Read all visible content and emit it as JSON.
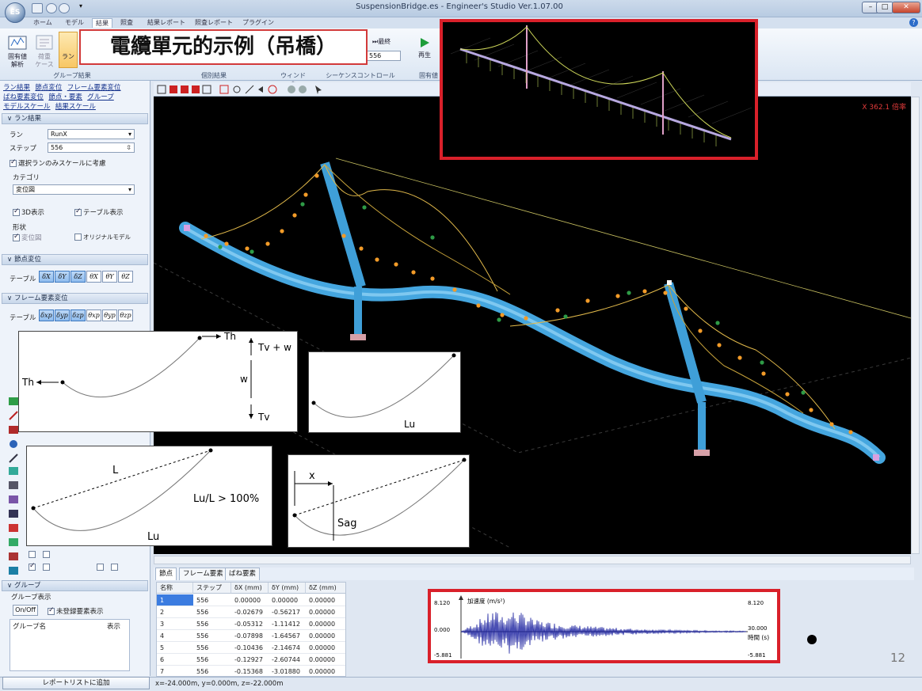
{
  "window": {
    "title": "SuspensionBridge.es - Engineer's Studio Ver.1.07.00",
    "app_logo": "ES",
    "controls": [
      "minimize-icon",
      "maximize-icon",
      "close-icon"
    ]
  },
  "menu": {
    "items": [
      "ホーム",
      "モデル",
      "結果",
      "照査",
      "結果レポート",
      "照査レポート",
      "プラグイン"
    ],
    "active": "結果",
    "help": "?"
  },
  "ribbon": {
    "buttons": {
      "eigen": "固有値\n解析",
      "load_case": "荷重\nケース",
      "run": "ラン",
      "last": "最終",
      "step_value": "556",
      "play": "再生",
      "eigen_short": "固有値"
    },
    "groups": [
      "グループ結果",
      "個別結果",
      "ウィンドウ",
      "シーケンスコントロール",
      "固有値"
    ]
  },
  "overlay_title": "電纜單元的示例（吊橋）",
  "panel": {
    "links_row1": [
      "ラン結果",
      "節点変位",
      "フレーム要素変位"
    ],
    "links_row2": [
      "ばね要素変位",
      "節点・要素",
      "グループ"
    ],
    "links_row3": [
      "モデルスケール",
      "結果スケール"
    ],
    "run_section": {
      "header": "ラン結果",
      "run_label": "ラン",
      "run_value": "RunX",
      "step_label": "ステップ",
      "step_value": "556",
      "scale_check": "選択ランのみスケールに考慮",
      "category_label": "カテゴリ",
      "category_value": "変位図",
      "show_3d": "3D表示",
      "show_table": "テーブル表示",
      "shape_label": "形状",
      "disp_fig": "変位図",
      "original_model": "オリジナルモデル"
    },
    "node_disp": {
      "header": "節点変位",
      "table_label": "テーブル",
      "buttons": [
        "δX",
        "δY",
        "δZ",
        "θX",
        "θY",
        "θZ"
      ]
    },
    "frame_disp": {
      "header": "フレーム要素変位",
      "table_label": "テーブル",
      "buttons": [
        "δxp",
        "δyp",
        "δzp",
        "θxp",
        "θyp",
        "θzp"
      ]
    },
    "group": {
      "header": "グループ",
      "display_label": "グループ表示",
      "onoff": "On/Off",
      "unreg": "未登録要素表示",
      "col_name": "グループ名",
      "col_show": "表示"
    },
    "report_button": "レポートリストに追加"
  },
  "viewer": {
    "scale_label": "X 362.1 倍率"
  },
  "diagrams": {
    "card1": {
      "th_right": "Th",
      "th_left": "Th",
      "tv_w": "Tv + w",
      "w": "w",
      "tv": "Tv"
    },
    "card2": {
      "lu": "Lu"
    },
    "card3": {
      "l": "L",
      "ratio": "Lu/L > 100%",
      "lu": "Lu"
    },
    "card4": {
      "x": "x",
      "sag": "Sag"
    }
  },
  "tabs": [
    "節点",
    "フレーム要素",
    "ばね要素"
  ],
  "table": {
    "headers": [
      "名称",
      "ステップ",
      "δX (mm)",
      "δY (mm)",
      "δZ (mm)"
    ],
    "rows": [
      [
        "1",
        "556",
        "0.00000",
        "0.00000",
        "0.00000"
      ],
      [
        "2",
        "556",
        "-0.02679",
        "-0.56217",
        "0.00000"
      ],
      [
        "3",
        "556",
        "-0.05312",
        "-1.11412",
        "0.00000"
      ],
      [
        "4",
        "556",
        "-0.07898",
        "-1.64567",
        "0.00000"
      ],
      [
        "5",
        "556",
        "-0.10436",
        "-2.14674",
        "0.00000"
      ],
      [
        "6",
        "556",
        "-0.12927",
        "-2.60744",
        "0.00000"
      ],
      [
        "7",
        "556",
        "-0.15368",
        "-3.01880",
        "0.00000"
      ]
    ]
  },
  "accel_graph": {
    "ylabel": "加速度 (m/s²)",
    "y_max_left": "8.120",
    "y_zero_left": "0.000",
    "y_min_left": "-5.881",
    "y_max_right": "8.120",
    "x_max_right": "30.000",
    "y_min_right": "-5.881",
    "xlabel": "時間 (s)"
  },
  "status": {
    "coords": "x=-24.000m, y=0.000m, z=-22.000m"
  },
  "page_number": "12"
}
